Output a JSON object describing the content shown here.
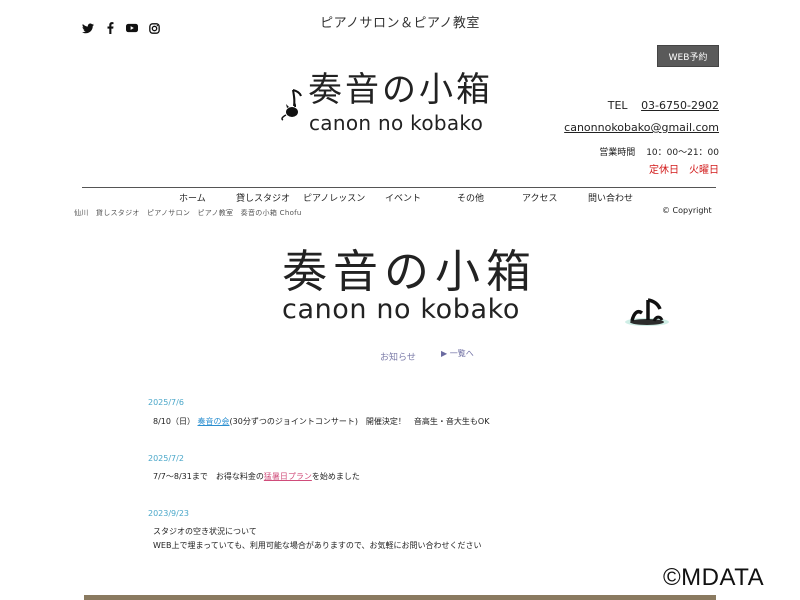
{
  "header": {
    "site_subtitle": "ピアノサロン＆ピアノ教室",
    "web_reserve_label": "WEB予約",
    "social_icons": [
      "twitter-icon",
      "facebook-icon",
      "youtube-icon",
      "instagram-icon"
    ],
    "logo_jp": "奏音の小箱",
    "logo_en": "canon no kobako",
    "tel_label": "TEL",
    "tel_number": "03-6750-2902",
    "email": "canonnokobako@gmail.com",
    "hours_label": "営業時間",
    "hours_value": "10：00〜21：00",
    "closed_text": "定休日　火曜日",
    "closed_color": "#d21a1a"
  },
  "nav": {
    "items": [
      {
        "label": "ホーム"
      },
      {
        "label": "貸しスタジオ"
      },
      {
        "label": "ピアノレッスン"
      },
      {
        "label": "イベント"
      },
      {
        "label": "その他"
      },
      {
        "label": "アクセス"
      },
      {
        "label": "問い合わせ"
      }
    ]
  },
  "breadcrumb": "仙川　貸しスタジオ　ピアノサロン　ピアノ教室　奏音の小箱 Chofu",
  "copyright": "© Copyright",
  "hero": {
    "logo_jp": "奏音の小箱",
    "logo_en": "canon no kobako"
  },
  "news": {
    "title": "お知らせ",
    "more_label": "▶ 一覧へ",
    "items": [
      {
        "date": "2025/7/6",
        "text_before": "8/10（日）",
        "link": "奏音の会",
        "text_after": "(30分ずつのジョイントコンサート)　開催決定！　音高生・音大生もOK"
      },
      {
        "date": "2025/7/2",
        "text_before": "7/7〜8/31まで　お得な料金の",
        "link": "猛暑日プラン",
        "text_after": "を始めました"
      },
      {
        "date": "2023/9/23",
        "line1": "スタジオの空き状況について",
        "line2": "WEB上で埋まっていても、利用可能な場合がありますので、お気軽にお問い合わせください"
      }
    ]
  },
  "watermark": "©MDATA",
  "colors": {
    "accent_date": "#4aa7c9",
    "link_blue": "#2b8fd0",
    "link_pink": "#d04c7a",
    "button_bg": "#5a5a5a"
  }
}
